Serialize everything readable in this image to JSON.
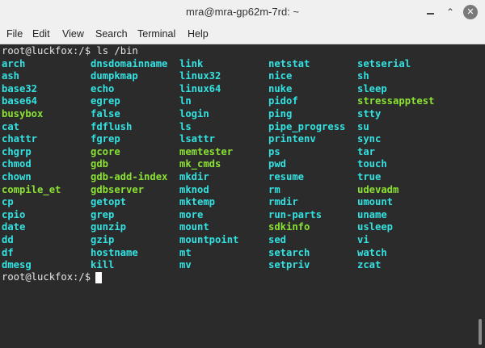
{
  "window": {
    "title": "mra@mra-gp62m-7rd: ~"
  },
  "menu": [
    "File",
    "Edit",
    "View",
    "Search",
    "Terminal",
    "Help"
  ],
  "terminal": {
    "prompt_1": "root@luckfox:/$ ls /bin",
    "prompt_2": "root@luckfox:/$ ",
    "columns": [
      [
        "arch",
        "ash",
        "base32",
        "base64",
        "busybox",
        "cat",
        "chattr",
        "chgrp",
        "chmod",
        "chown",
        "compile_et",
        "cp",
        "cpio",
        "date",
        "dd",
        "df",
        "dmesg"
      ],
      [
        "dnsdomainname",
        "dumpkmap",
        "echo",
        "egrep",
        "false",
        "fdflush",
        "fgrep",
        "gcore",
        "gdb",
        "gdb-add-index",
        "gdbserver",
        "getopt",
        "grep",
        "gunzip",
        "gzip",
        "hostname",
        "kill"
      ],
      [
        "link",
        "linux32",
        "linux64",
        "ln",
        "login",
        "ls",
        "lsattr",
        "memtester",
        "mk_cmds",
        "mkdir",
        "mknod",
        "mktemp",
        "more",
        "mount",
        "mountpoint",
        "mt",
        "mv"
      ],
      [
        "netstat",
        "nice",
        "nuke",
        "pidof",
        "ping",
        "pipe_progress",
        "printenv",
        "ps",
        "pwd",
        "resume",
        "rm",
        "rmdir",
        "run-parts",
        "sdkinfo",
        "sed",
        "setarch",
        "setpriv"
      ],
      [
        "setserial",
        "sh",
        "sleep",
        "stressapptest",
        "stty",
        "su",
        "sync",
        "tar",
        "touch",
        "true",
        "udevadm",
        "umount",
        "uname",
        "usleep",
        "vi",
        "watch",
        "zcat"
      ]
    ],
    "green_entries": [
      "busybox",
      "compile_et",
      "gcore",
      "gdb",
      "gdb-add-index",
      "gdbserver",
      "memtester",
      "mk_cmds",
      "sdkinfo",
      "stressapptest",
      "udevadm"
    ],
    "colors": {
      "link": "#34e2e2",
      "executable": "#8ae234",
      "text": "#e6e6e6",
      "background": "#2b2b2b"
    }
  },
  "icons": {
    "minimize": "minimize-icon",
    "maximize": "maximize-icon",
    "close": "close-icon"
  }
}
